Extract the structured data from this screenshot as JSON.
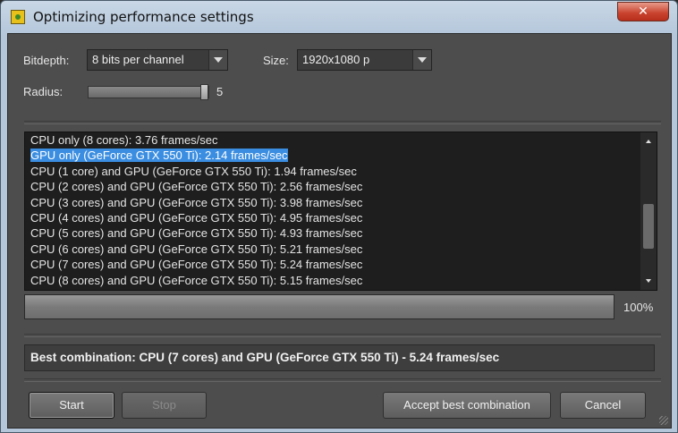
{
  "window": {
    "title": "Optimizing performance settings",
    "close_glyph": "✕"
  },
  "settings": {
    "bitdepth_label": "Bitdepth:",
    "bitdepth_value": "8 bits per channel",
    "size_label": "Size:",
    "size_value": "1920x1080 p",
    "radius_label": "Radius:",
    "radius_value": "5"
  },
  "results": {
    "items": [
      "CPU only (8 cores): 3.76 frames/sec",
      "GPU only (GeForce GTX 550 Ti): 2.14 frames/sec",
      "CPU (1 core) and GPU (GeForce GTX 550 Ti): 1.94 frames/sec",
      "CPU (2 cores) and GPU (GeForce GTX 550 Ti): 2.56 frames/sec",
      "CPU (3 cores) and GPU (GeForce GTX 550 Ti): 3.98 frames/sec",
      "CPU (4 cores) and GPU (GeForce GTX 550 Ti): 4.95 frames/sec",
      "CPU (5 cores) and GPU (GeForce GTX 550 Ti): 4.93 frames/sec",
      "CPU (6 cores) and GPU (GeForce GTX 550 Ti): 5.21 frames/sec",
      "CPU (7 cores) and GPU (GeForce GTX 550 Ti): 5.24 frames/sec",
      "CPU (8 cores) and GPU (GeForce GTX 550 Ti): 5.15 frames/sec"
    ],
    "selected_index": 1
  },
  "progress": {
    "value_percent": 100,
    "label": "100%"
  },
  "best": {
    "text": "Best combination: CPU (7 cores) and GPU (GeForce GTX 550 Ti) - 5.24 frames/sec"
  },
  "buttons": {
    "start": "Start",
    "stop": "Stop",
    "accept": "Accept best combination",
    "cancel": "Cancel"
  },
  "colors": {
    "selection": "#3a8de0",
    "client_bg": "#4d4d4d",
    "close": "#c8412c"
  }
}
